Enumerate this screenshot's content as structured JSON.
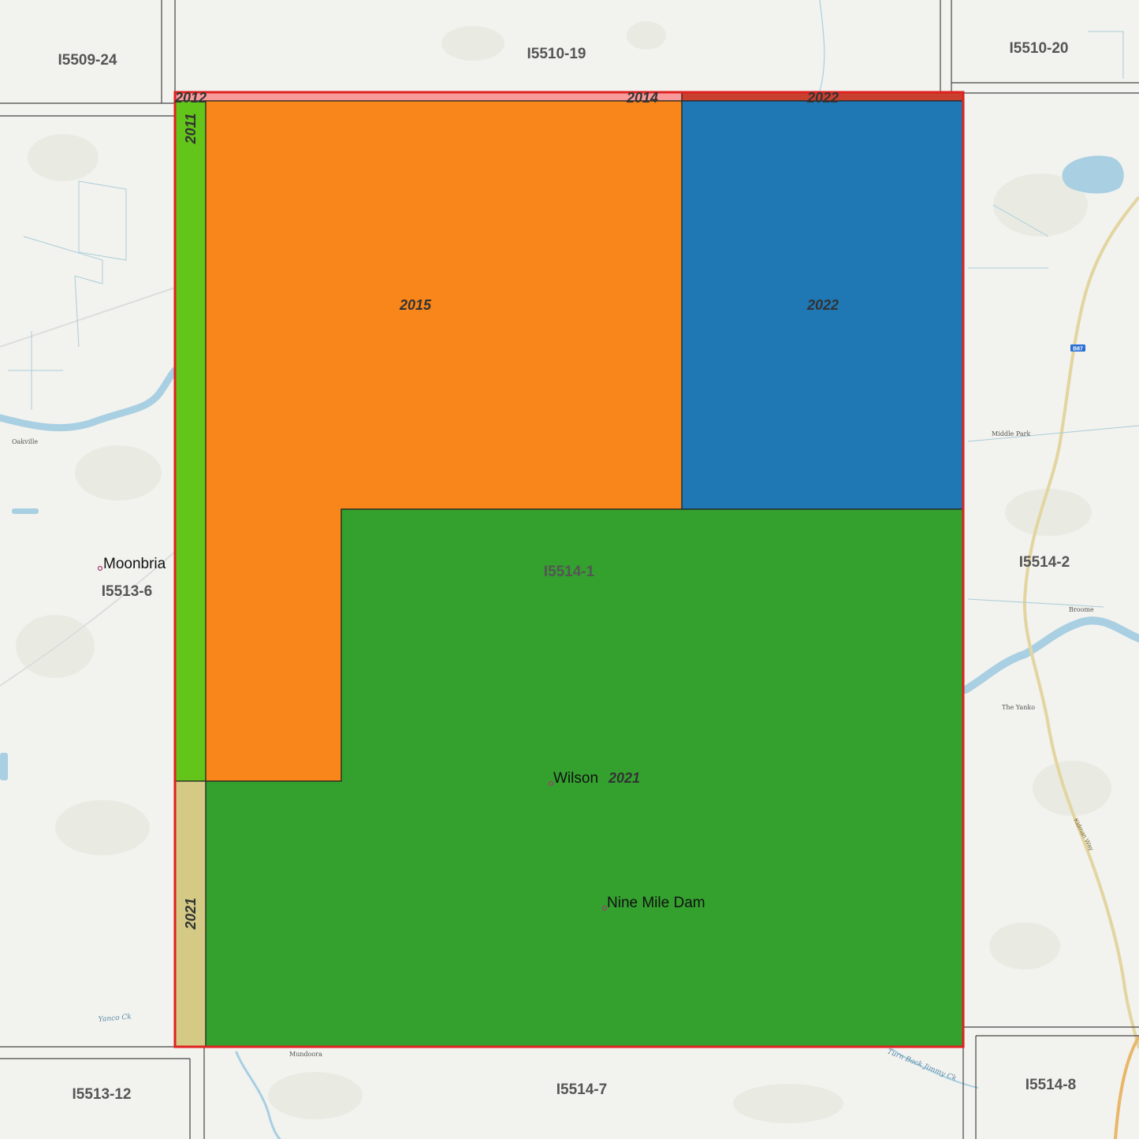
{
  "colors": {
    "background": "#f2f2ee",
    "orange": "#f8861a",
    "blue": "#1f77b4",
    "green": "#34a12f",
    "lime": "#63c51a",
    "tan": "#d4ca85",
    "pink": "#f89a9a",
    "darkred": "#c9402f",
    "outline": "#e02020",
    "water": "#a8cfe2"
  },
  "sheets": {
    "i5509_24": "I5509-24",
    "i5510_19": "I5510-19",
    "i5510_20": "I5510-20",
    "i5513_6": "I5513-6",
    "i5514_1": "I5514-1",
    "i5514_2": "I5514-2",
    "i5513_12": "I5513-12",
    "i5514_7": "I5514-7",
    "i5514_8": "I5514-8"
  },
  "years": {
    "strip_2012": "2012",
    "strip_2014": "2014",
    "strip_2022": "2022",
    "left_2011": "2011",
    "orange_2015": "2015",
    "blue_2022": "2022",
    "green_2021": "2021",
    "tan_2021": "2021"
  },
  "places": {
    "moonbria": "Moonbria",
    "wilson": "Wilson",
    "nine_mile_dam": "Nine Mile Dam"
  },
  "small_places": {
    "oakville": "Oakville",
    "middle_park": "Middle Park",
    "the_yanko": "The Yanko",
    "broome": "Broome",
    "mundoora": "Mundoora"
  },
  "roads": {
    "b87": "B87",
    "kidman_way": "Kidman Way"
  },
  "creeks": {
    "yanco": "Yanco Ck",
    "turn_back_jimmy": "Turn Back Jimmy Ck"
  }
}
